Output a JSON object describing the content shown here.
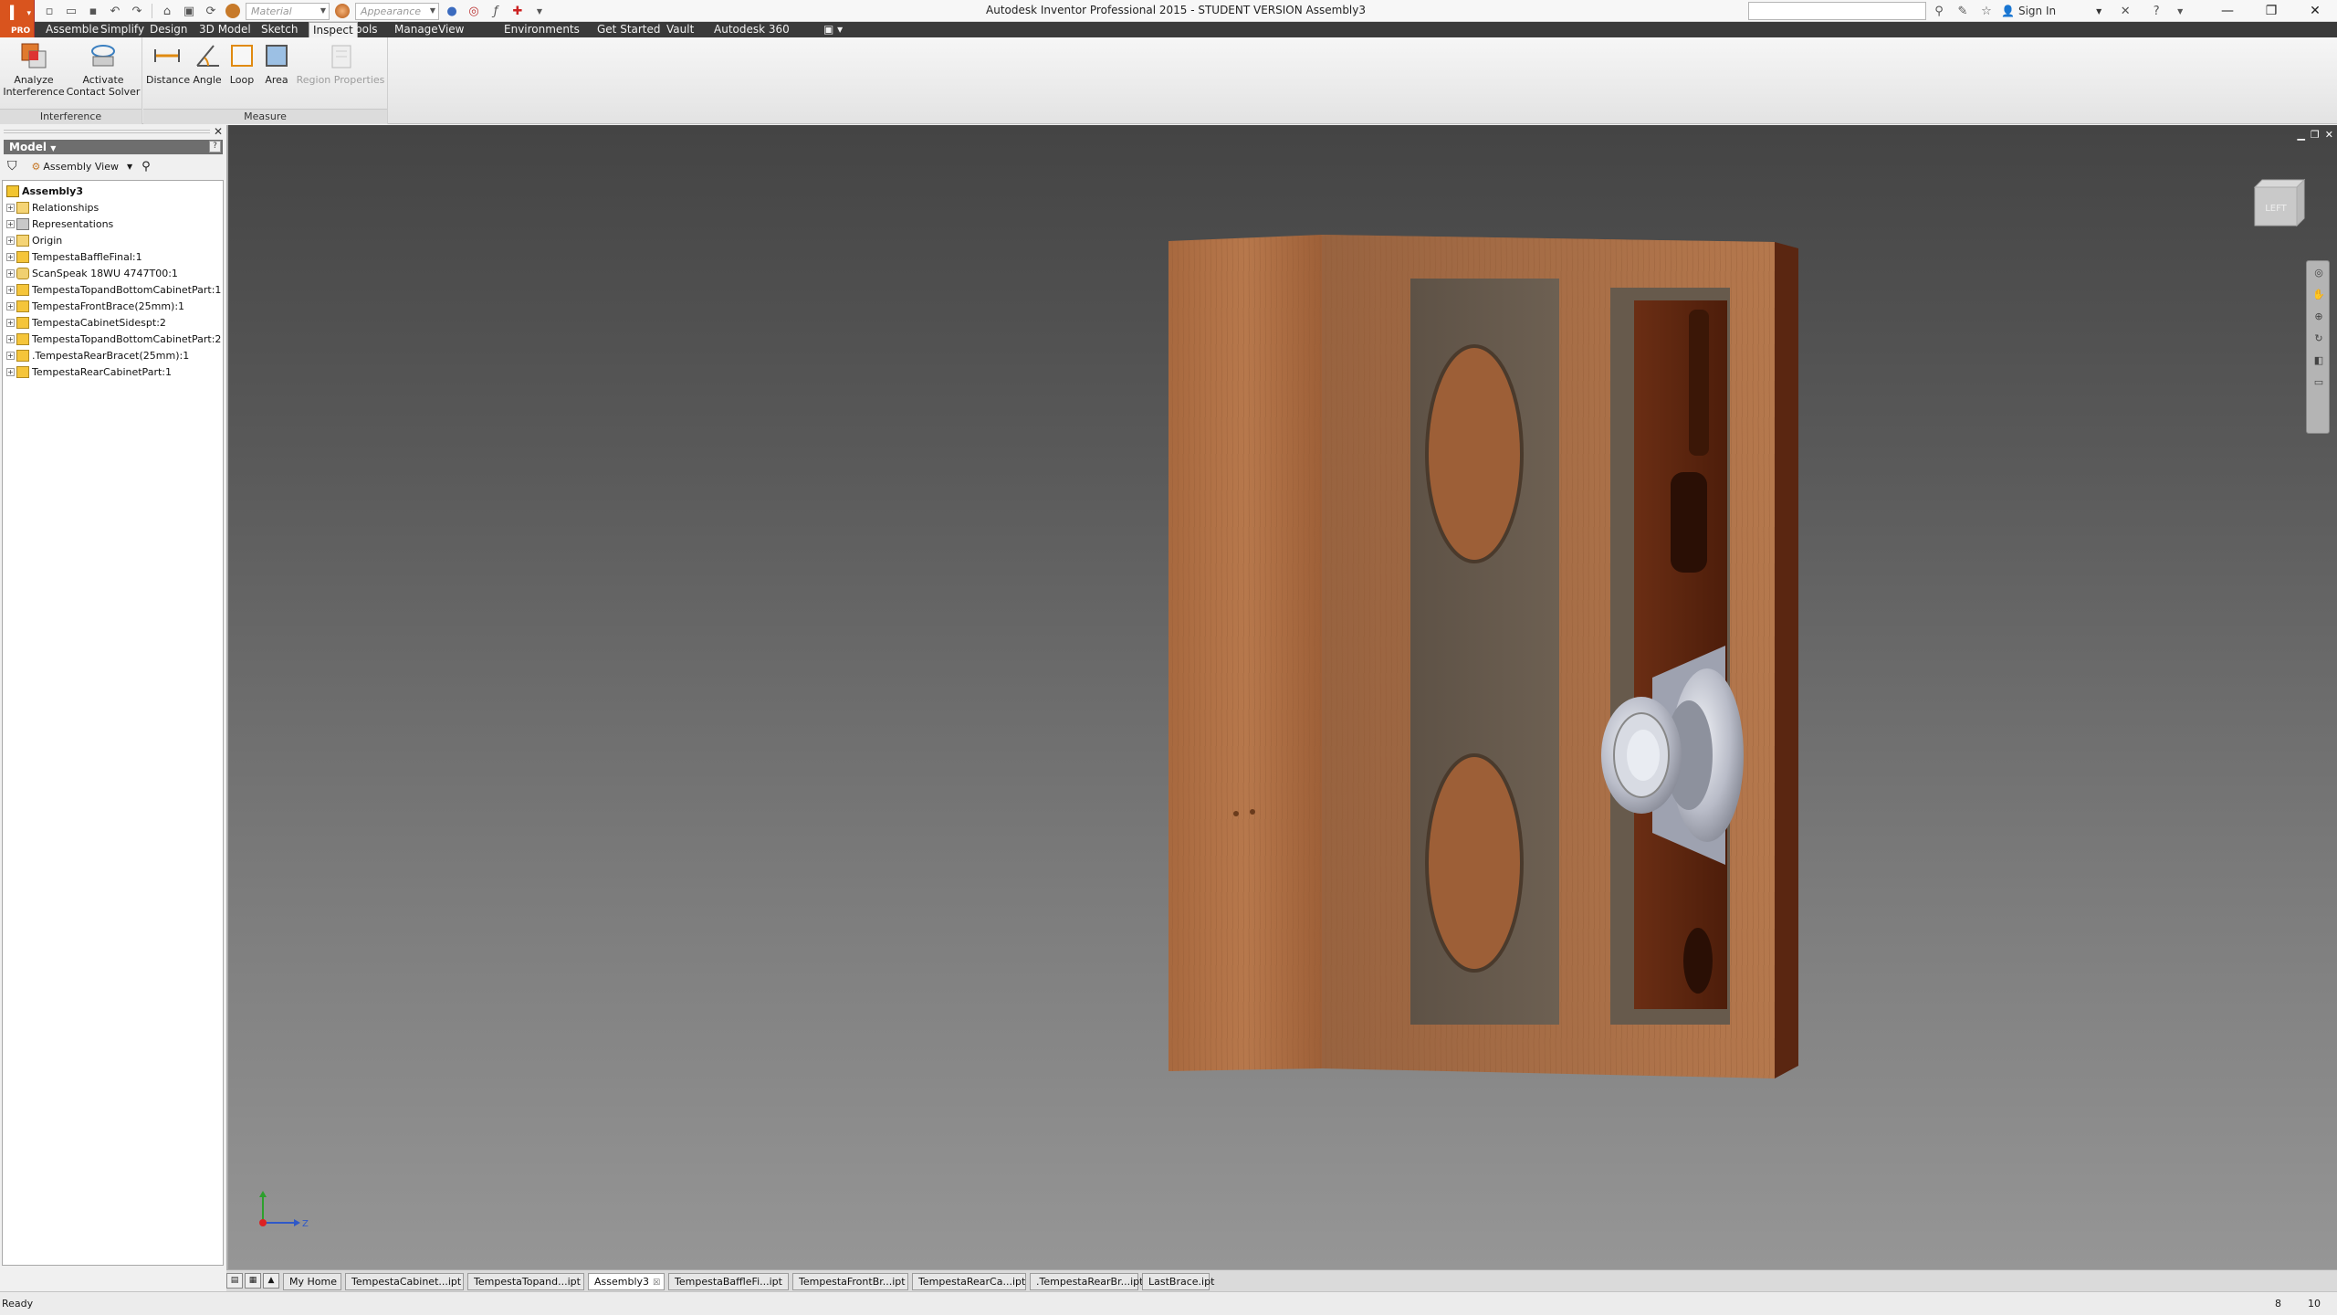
{
  "app": {
    "window_title": "Autodesk Inventor Professional 2015 - STUDENT VERSION    Assembly3",
    "logo_letter": "I",
    "logo_badge": "PRO"
  },
  "qat": {
    "material_placeholder": "Material",
    "appearance_placeholder": "Appearance",
    "icons": [
      "new-icon",
      "open-icon",
      "save-icon",
      "undo-icon",
      "redo-icon",
      "home-icon",
      "select-icon",
      "update-icon",
      "color-icon",
      "fx-icon",
      "measure-icon"
    ]
  },
  "info_center": {
    "search_placeholder": "",
    "sign_in": "Sign In"
  },
  "ribbon_tabs": [
    {
      "label": "Assemble"
    },
    {
      "label": "Simplify"
    },
    {
      "label": "Design"
    },
    {
      "label": "3D Model"
    },
    {
      "label": "Sketch"
    },
    {
      "label": "Inspect",
      "active": true
    },
    {
      "label": "Tools"
    },
    {
      "label": "Manage"
    },
    {
      "label": "View"
    },
    {
      "label": "Environments"
    },
    {
      "label": "Get Started"
    },
    {
      "label": "Vault"
    },
    {
      "label": "Autodesk 360"
    }
  ],
  "ribbon": {
    "interference": {
      "title": "Interference",
      "analyze_line1": "Analyze",
      "analyze_line2": "Interference",
      "contact_line1": "Activate",
      "contact_line2": "Contact Solver"
    },
    "measure": {
      "title": "Measure",
      "distance": "Distance",
      "angle": "Angle",
      "loop": "Loop",
      "area": "Area",
      "region_properties": "Region Properties"
    }
  },
  "browser": {
    "header": "Model",
    "view_select": "Assembly View",
    "tree": [
      {
        "label": "Assembly3",
        "icon": "assembly-icon",
        "root": true
      },
      {
        "label": "Relationships",
        "icon": "folder-icon"
      },
      {
        "label": "Representations",
        "icon": "representations-icon"
      },
      {
        "label": "Origin",
        "icon": "folder-icon"
      },
      {
        "label": "TempestaBaffleFinal:1",
        "icon": "part-icon"
      },
      {
        "label": "ScanSpeak 18WU 4747T00:1",
        "icon": "subassembly-icon"
      },
      {
        "label": "TempestaTopandBottomCabinetPart:1",
        "icon": "part-icon"
      },
      {
        "label": "TempestaFrontBrace(25mm):1",
        "icon": "part-icon"
      },
      {
        "label": "TempestaCabinetSidespt:2",
        "icon": "part-icon"
      },
      {
        "label": "TempestaTopandBottomCabinetPart:2",
        "icon": "part-icon"
      },
      {
        "label": ".TempestaRearBracet(25mm):1",
        "icon": "part-icon"
      },
      {
        "label": "TempestaRearCabinetPart:1",
        "icon": "part-icon"
      }
    ]
  },
  "viewport": {
    "viewcube_label": "LEFT",
    "triad": {
      "y": "Y",
      "z": "Z"
    }
  },
  "doc_tabs": [
    {
      "label": "My Home"
    },
    {
      "label": "TempestaCabinet...ipt"
    },
    {
      "label": "TempestaTopand...ipt"
    },
    {
      "label": "Assembly3",
      "active": true,
      "close": "☒"
    },
    {
      "label": "TempestaBaffleFi...ipt"
    },
    {
      "label": "TempestaFrontBr...ipt"
    },
    {
      "label": "TempestaRearCa...ipt"
    },
    {
      "label": ".TempestaRearBr...ipt"
    },
    {
      "label": "LastBrace.ipt"
    }
  ],
  "status": {
    "text": "Ready",
    "count1": "8",
    "count2": "10"
  },
  "colors": {
    "logo": "#d9541e",
    "ribbon_tab_bar": "#3a3a3a",
    "wood": "#a8683e",
    "viewport_top": "#444444",
    "viewport_bottom": "#969696"
  }
}
